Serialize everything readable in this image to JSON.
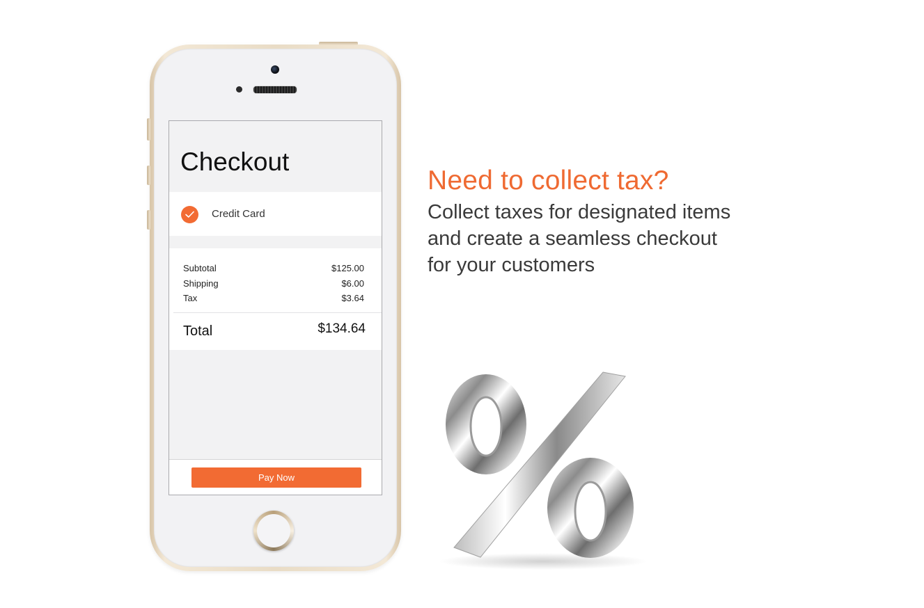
{
  "screen": {
    "title": "Checkout",
    "payment_method": "Credit Card",
    "summary": [
      {
        "label": "Subtotal",
        "value": "$125.00"
      },
      {
        "label": "Shipping",
        "value": "$6.00"
      },
      {
        "label": "Tax",
        "value": "$3.64"
      }
    ],
    "total_label": "Total",
    "total_value": "$134.64",
    "pay_button": "Pay Now"
  },
  "promo": {
    "headline": "Need to collect tax?",
    "lines": [
      "Collect taxes for designated items",
      "and create a seamless checkout",
      "for your customers"
    ]
  },
  "colors": {
    "accent": "#f26b33",
    "headline": "#ef6a32",
    "body_text": "#3a3a3a"
  },
  "icons": [
    "checkmark-icon",
    "percent-sign-icon"
  ]
}
